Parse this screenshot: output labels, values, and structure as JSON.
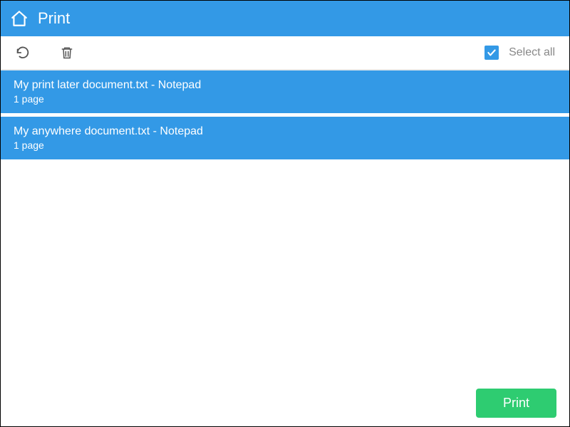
{
  "header": {
    "title": "Print"
  },
  "toolbar": {
    "select_all_label": "Select all",
    "select_all_checked": true
  },
  "documents": [
    {
      "title": "My print later document.txt - Notepad",
      "pages": "1 page"
    },
    {
      "title": "My anywhere document.txt - Notepad",
      "pages": "1 page"
    }
  ],
  "footer": {
    "print_label": "Print"
  },
  "colors": {
    "primary": "#3399e6",
    "action": "#2ecc71"
  }
}
